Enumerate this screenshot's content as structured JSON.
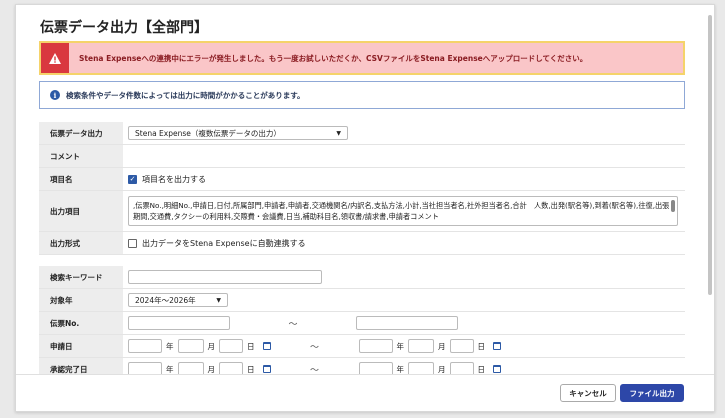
{
  "page": {
    "title": "伝票データ出力【全部門】"
  },
  "error": {
    "message": "Stena Expenseへの連携中にエラーが発生しました。もう一度お試しいただくか、CSVファイルをStena Expenseへアップロードしてください。"
  },
  "info": {
    "message": "検索条件やデータ件数によっては出力に時間がかかることがあります。",
    "icon_char": "i"
  },
  "form": {
    "output_data": {
      "label": "伝票データ出力",
      "value": "Stena Expense（複数伝票データの出力）"
    },
    "comment": {
      "label": "コメント"
    },
    "item_name": {
      "label": "項目名",
      "checkbox_label": "項目名を出力する",
      "checked": true
    },
    "output_items": {
      "label": "出力項目",
      "value": ",伝票No.,明細No.,申請日,日付,所属部門,申請者,申請者,交通機関名/内訳名,支払方法,小計,当社担当者名,社外担当者名,合計　人数,出発(駅名等),到着(駅名等),往復,出張期間,交通費,タクシーの利用料,交際費・会議費,日当,補助科目名,領収書/請求書,申請者コメント"
    },
    "output_format": {
      "label": "出力形式",
      "checkbox_label": "出力データをStena Expenseに自動連携する",
      "checked": false
    },
    "search_keyword": {
      "label": "検索キーワード",
      "value": ""
    },
    "target_year": {
      "label": "対象年",
      "value": "2024年～2026年"
    },
    "slip_no": {
      "label": "伝票No.",
      "tilde": "～"
    },
    "apply_date": {
      "label": "申請日",
      "year_unit": "年",
      "month_unit": "月",
      "day_unit": "日",
      "tilde": "～"
    },
    "approve_date": {
      "label": "承認完了日",
      "year_unit": "年",
      "month_unit": "月",
      "day_unit": "日",
      "tilde": "～"
    }
  },
  "footer": {
    "cancel_label": "キャンセル",
    "submit_label": "ファイル出力"
  },
  "colors": {
    "primary": "#2d47a8",
    "error_bg": "#fac6c8",
    "error_border": "#f5d36a",
    "error_icon_bg": "#d9383f"
  }
}
